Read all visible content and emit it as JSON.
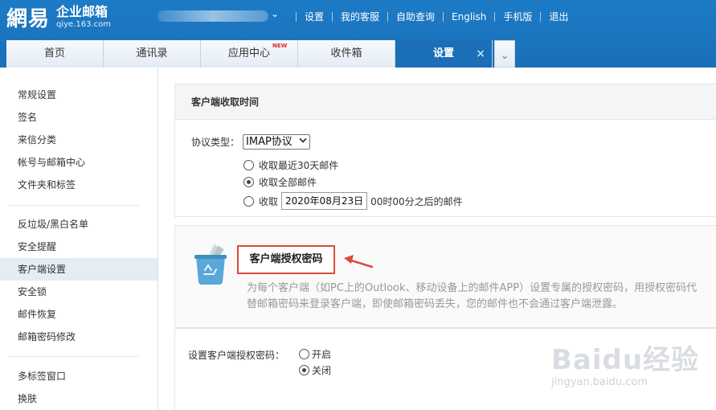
{
  "brand": {
    "logo_mark": "網易",
    "product": "企业邮箱",
    "domain": "qiye.163.com"
  },
  "account": {
    "caret": "⌄"
  },
  "top_links": [
    "设置",
    "我的客服",
    "自助查询",
    "English",
    "手机版",
    "退出"
  ],
  "tabs": [
    {
      "label": "首页"
    },
    {
      "label": "通讯录"
    },
    {
      "label": "应用中心",
      "badge": "NEW"
    },
    {
      "label": "收件箱"
    },
    {
      "label": "设置",
      "close": "×"
    }
  ],
  "tab_more_icon": "chevron-down-icon",
  "sidebar": {
    "group1": [
      "常规设置",
      "签名",
      "来信分类",
      "帐号与邮箱中心",
      "文件夹和标签"
    ],
    "group2": [
      "反垃圾/黑白名单",
      "安全提醒",
      "客户端设置",
      "安全锁",
      "邮件恢复",
      "邮箱密码修改"
    ],
    "group3": [
      "多标签窗口",
      "换肤"
    ],
    "active": "客户端设置"
  },
  "client_fetch": {
    "title": "客户端收取时间",
    "protocol_label": "协议类型：",
    "protocol_value": "IMAP协议",
    "options": [
      {
        "label": "收取最近30天邮件",
        "checked": false
      },
      {
        "label": "收取全部邮件",
        "checked": true
      }
    ],
    "custom_prefix": "收取",
    "custom_date": "2020年08月23日",
    "custom_suffix": "00时00分之后的邮件",
    "custom_checked": false
  },
  "auth": {
    "title": "客户端授权密码",
    "description": "为每个客户端（如PC上的Outlook、移动设备上的邮件APP）设置专属的授权密码，用授权密码代替邮箱密码来登录客户端，即使邮箱密码丢失，您的邮件也不会通过客户端泄露。",
    "setting_label": "设置客户端授权密码：",
    "on_label": "开启",
    "off_label": "关闭",
    "enabled": false,
    "icon": "recycle-bin-icon"
  },
  "watermark": {
    "logo": "Baidu经验",
    "url": "jingyan.baidu.com"
  },
  "colors": {
    "header_blue": "#1a6fb8",
    "sidebar_active": "#e4ecf4",
    "highlight_red": "#d94a3a"
  }
}
